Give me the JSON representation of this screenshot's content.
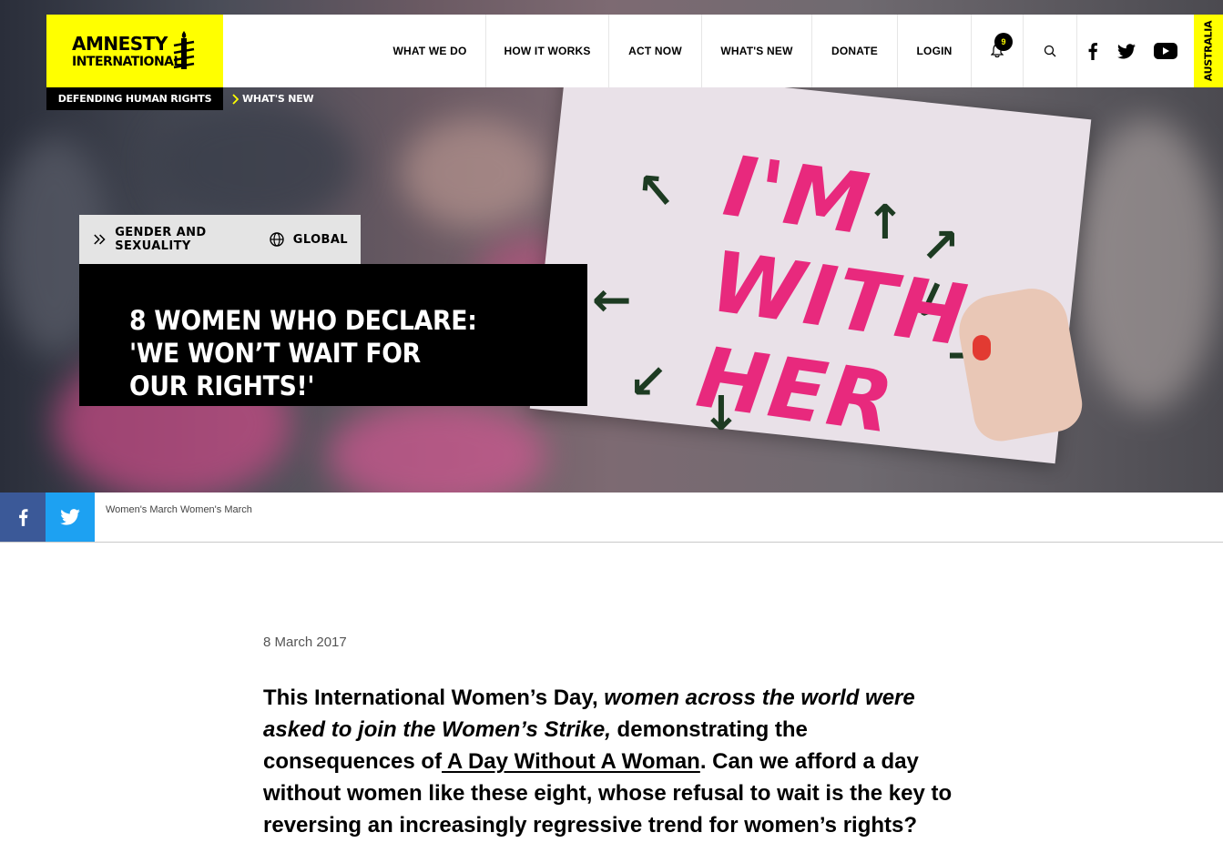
{
  "logo": {
    "line1": "AMNESTY",
    "line2": "INTERNATIONAL"
  },
  "strapline": "DEFENDING HUMAN RIGHTS",
  "breadcrumb": {
    "label": "WHAT'S NEW"
  },
  "nav": {
    "items": [
      {
        "label": "WHAT WE DO"
      },
      {
        "label": "HOW IT WORKS"
      },
      {
        "label": "ACT NOW"
      },
      {
        "label": "WHAT'S NEW"
      },
      {
        "label": "DONATE"
      },
      {
        "label": "LOGIN"
      }
    ],
    "notification_count": "9",
    "icons": [
      "bell-icon",
      "search-icon",
      "facebook-icon",
      "twitter-icon",
      "youtube-icon"
    ]
  },
  "region_tab": "AUSTRALIA",
  "hero": {
    "sign_lines": [
      "I'M",
      "WITH",
      "HER"
    ],
    "tags": [
      {
        "icon": "double-chevron-icon",
        "label": "GENDER AND SEXUALITY"
      },
      {
        "icon": "globe-icon",
        "label": "GLOBAL"
      }
    ],
    "title": "8 WOMEN WHO DECLARE: 'WE WON’T WAIT FOR OUR RIGHTS!'"
  },
  "share": {
    "caption": "Women's March Women's March",
    "colors": {
      "facebook": "#3b5998",
      "twitter": "#1da1f2"
    }
  },
  "article": {
    "date": "8 March 2017",
    "lead_part1": "This International Women’s Day, ",
    "lead_emphasis": "women across the world were asked to join the Women’s Strike,",
    "lead_part2": " demonstrating the consequences of",
    "lead_link": " A Day Without A Woman",
    "lead_part3": ". Can we afford a day without women like these eight, whose refusal to wait is the key to reversing an increasingly regressive trend for women’s rights?"
  },
  "colors": {
    "brand_yellow": "#ffff00",
    "sign_pink": "#e8297d"
  }
}
